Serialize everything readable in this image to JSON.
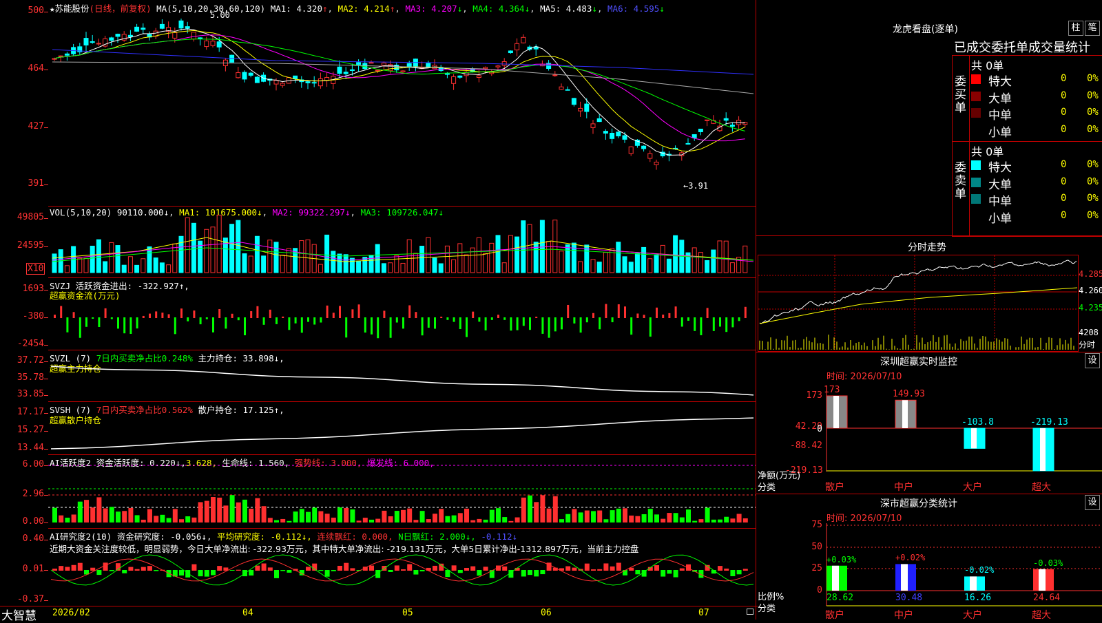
{
  "k_header": {
    "title": "苏能股份",
    "mode": "(日线，前复权)",
    "ma_prefix": "MA(5,10,20,30,60,120)",
    "ma1": "MA1: 4.320",
    "ma2": "MA2: 4.214",
    "ma3": "MA3: 4.207",
    "ma4": "MA4: 4.364",
    "ma5": "MA5: 4.483",
    "ma6": "MA6: 4.595",
    "high_note": "5.00",
    "low_note": "←3.91"
  },
  "k_axis": [
    "500",
    "464",
    "427",
    "391"
  ],
  "vol_header": {
    "prefix": "VOL(5,10,20)",
    "v": "90110.000↓",
    "ma1": "MA1: 101675.000↓",
    "ma2": "MA2: 99322.297↓",
    "ma3": "MA3: 109726.047↓"
  },
  "vol_axis": [
    "49805",
    "24595"
  ],
  "vol_unit": "X10",
  "svzj_header": {
    "name": "SVZJ",
    "text": "活跃资金进出: -322.927↑,",
    "sub": "超赢资金流(万元)"
  },
  "svzj_axis": [
    "1693",
    "-380",
    "-2454"
  ],
  "svzl_header": {
    "name": "SVZL (7)",
    "a": "7日内买卖净占比0.248%",
    "b": "主力持仓: 33.898↓,",
    "sub": "超赢主力持仓"
  },
  "svzl_axis": [
    "37.72",
    "35.78",
    "33.85"
  ],
  "svsh_header": {
    "name": "SVSH (7)",
    "a": "7日内买卖净占比0.562%",
    "b": "散户持仓: 17.125↑,",
    "sub": "超赢散户持仓"
  },
  "svsh_axis": [
    "17.17",
    "15.27",
    "13.44"
  ],
  "ai1_header": {
    "name": "AI活跃度2",
    "a": "资金活跃度: 0.220↓,",
    "b": "3.628,",
    "c": "生命线: 1.560,",
    "d": "强势线: 3.000,",
    "e": "爆发线: 6.000,"
  },
  "ai1_axis": [
    "6.00",
    "2.96",
    "0.00"
  ],
  "ai2_header": {
    "name": "AI研究度2(10)",
    "a": "资金研究度: -0.056↓,",
    "b": "平均研究度: -0.112↓,",
    "c": "连续飘红: 0.000,",
    "d": "N日飘红: 2.000↓,",
    "e": "-0.112↓",
    "f": "近期大资金关注度较低，明显弱势，今日大单净流出: -322.93万元，其中特大单净流出: -219.131万元，大单5日累计净出-1312.897万元，当前主力控盘"
  },
  "ai2_axis": [
    "0.40",
    "0.01",
    "-0.37"
  ],
  "date_axis": {
    "brand": "大智慧",
    "labels": [
      "2026/02",
      "04",
      "05",
      "06",
      "07"
    ]
  },
  "dragon": {
    "title": "龙虎看盘(逐单)",
    "btn1": "柱",
    "btn2": "笔",
    "sub": "已成交委托单成交量统计",
    "buy_label": "委买单",
    "sell_label": "委卖单",
    "buy_total": "共 0单",
    "sell_total": "共 0单",
    "buy_rows": [
      {
        "name": "特大",
        "n": "0",
        "p": "0%",
        "color": "#ff0000"
      },
      {
        "name": "大单",
        "n": "0",
        "p": "0%",
        "color": "#880000"
      },
      {
        "name": "中单",
        "n": "0",
        "p": "0%",
        "color": "#660000"
      },
      {
        "name": "小单",
        "n": "0",
        "p": "0%",
        "color": "#000000"
      }
    ],
    "sell_rows": [
      {
        "name": "特大",
        "n": "0",
        "p": "0%",
        "color": "#00ffff"
      },
      {
        "name": "大单",
        "n": "0",
        "p": "0%",
        "color": "#008888"
      },
      {
        "name": "中单",
        "n": "0",
        "p": "0%",
        "color": "#007777"
      },
      {
        "name": "小单",
        "n": "0",
        "p": "0%",
        "color": "#000000"
      }
    ]
  },
  "intraday": {
    "title": "分时走势",
    "prices": [
      "4.285",
      "4.260",
      "4.235"
    ],
    "vol": "4208",
    "unit": "分时"
  },
  "sz_monitor": {
    "title": "深圳超赢实时监控",
    "btn": "设",
    "time": "时间: 2026/07/10",
    "axis": [
      "173",
      "42.29",
      "0",
      "-88.42",
      "-219.13"
    ],
    "side": [
      "净额(万元)",
      "分类"
    ],
    "bars": [
      {
        "cat": "散户",
        "val": "173"
      },
      {
        "cat": "中户",
        "val": "149.93"
      },
      {
        "cat": "大户",
        "val": "-103.8"
      },
      {
        "cat": "超大",
        "val": "-219.13"
      }
    ]
  },
  "sz_stats": {
    "title": "深市超赢分类统计",
    "btn": "设",
    "time": "时间: 2026/07/10",
    "axis": [
      "75",
      "50",
      "25",
      "0"
    ],
    "side": [
      "比例%",
      "分类"
    ],
    "bars": [
      {
        "cat": "散户",
        "top": "+0.03%",
        "bottom": "28.62"
      },
      {
        "cat": "中户",
        "top": "+0.02%",
        "bottom": "30.48"
      },
      {
        "cat": "大户",
        "top": "-0.02%",
        "bottom": "16.26"
      },
      {
        "cat": "超大",
        "top": "-0.03%",
        "bottom": "24.64"
      }
    ]
  },
  "chart_data": {
    "type": "candlestick",
    "range_note": "2026/02 - 2026/07",
    "ylim": [
      391,
      500
    ],
    "high": 5.0,
    "low": 3.91
  }
}
